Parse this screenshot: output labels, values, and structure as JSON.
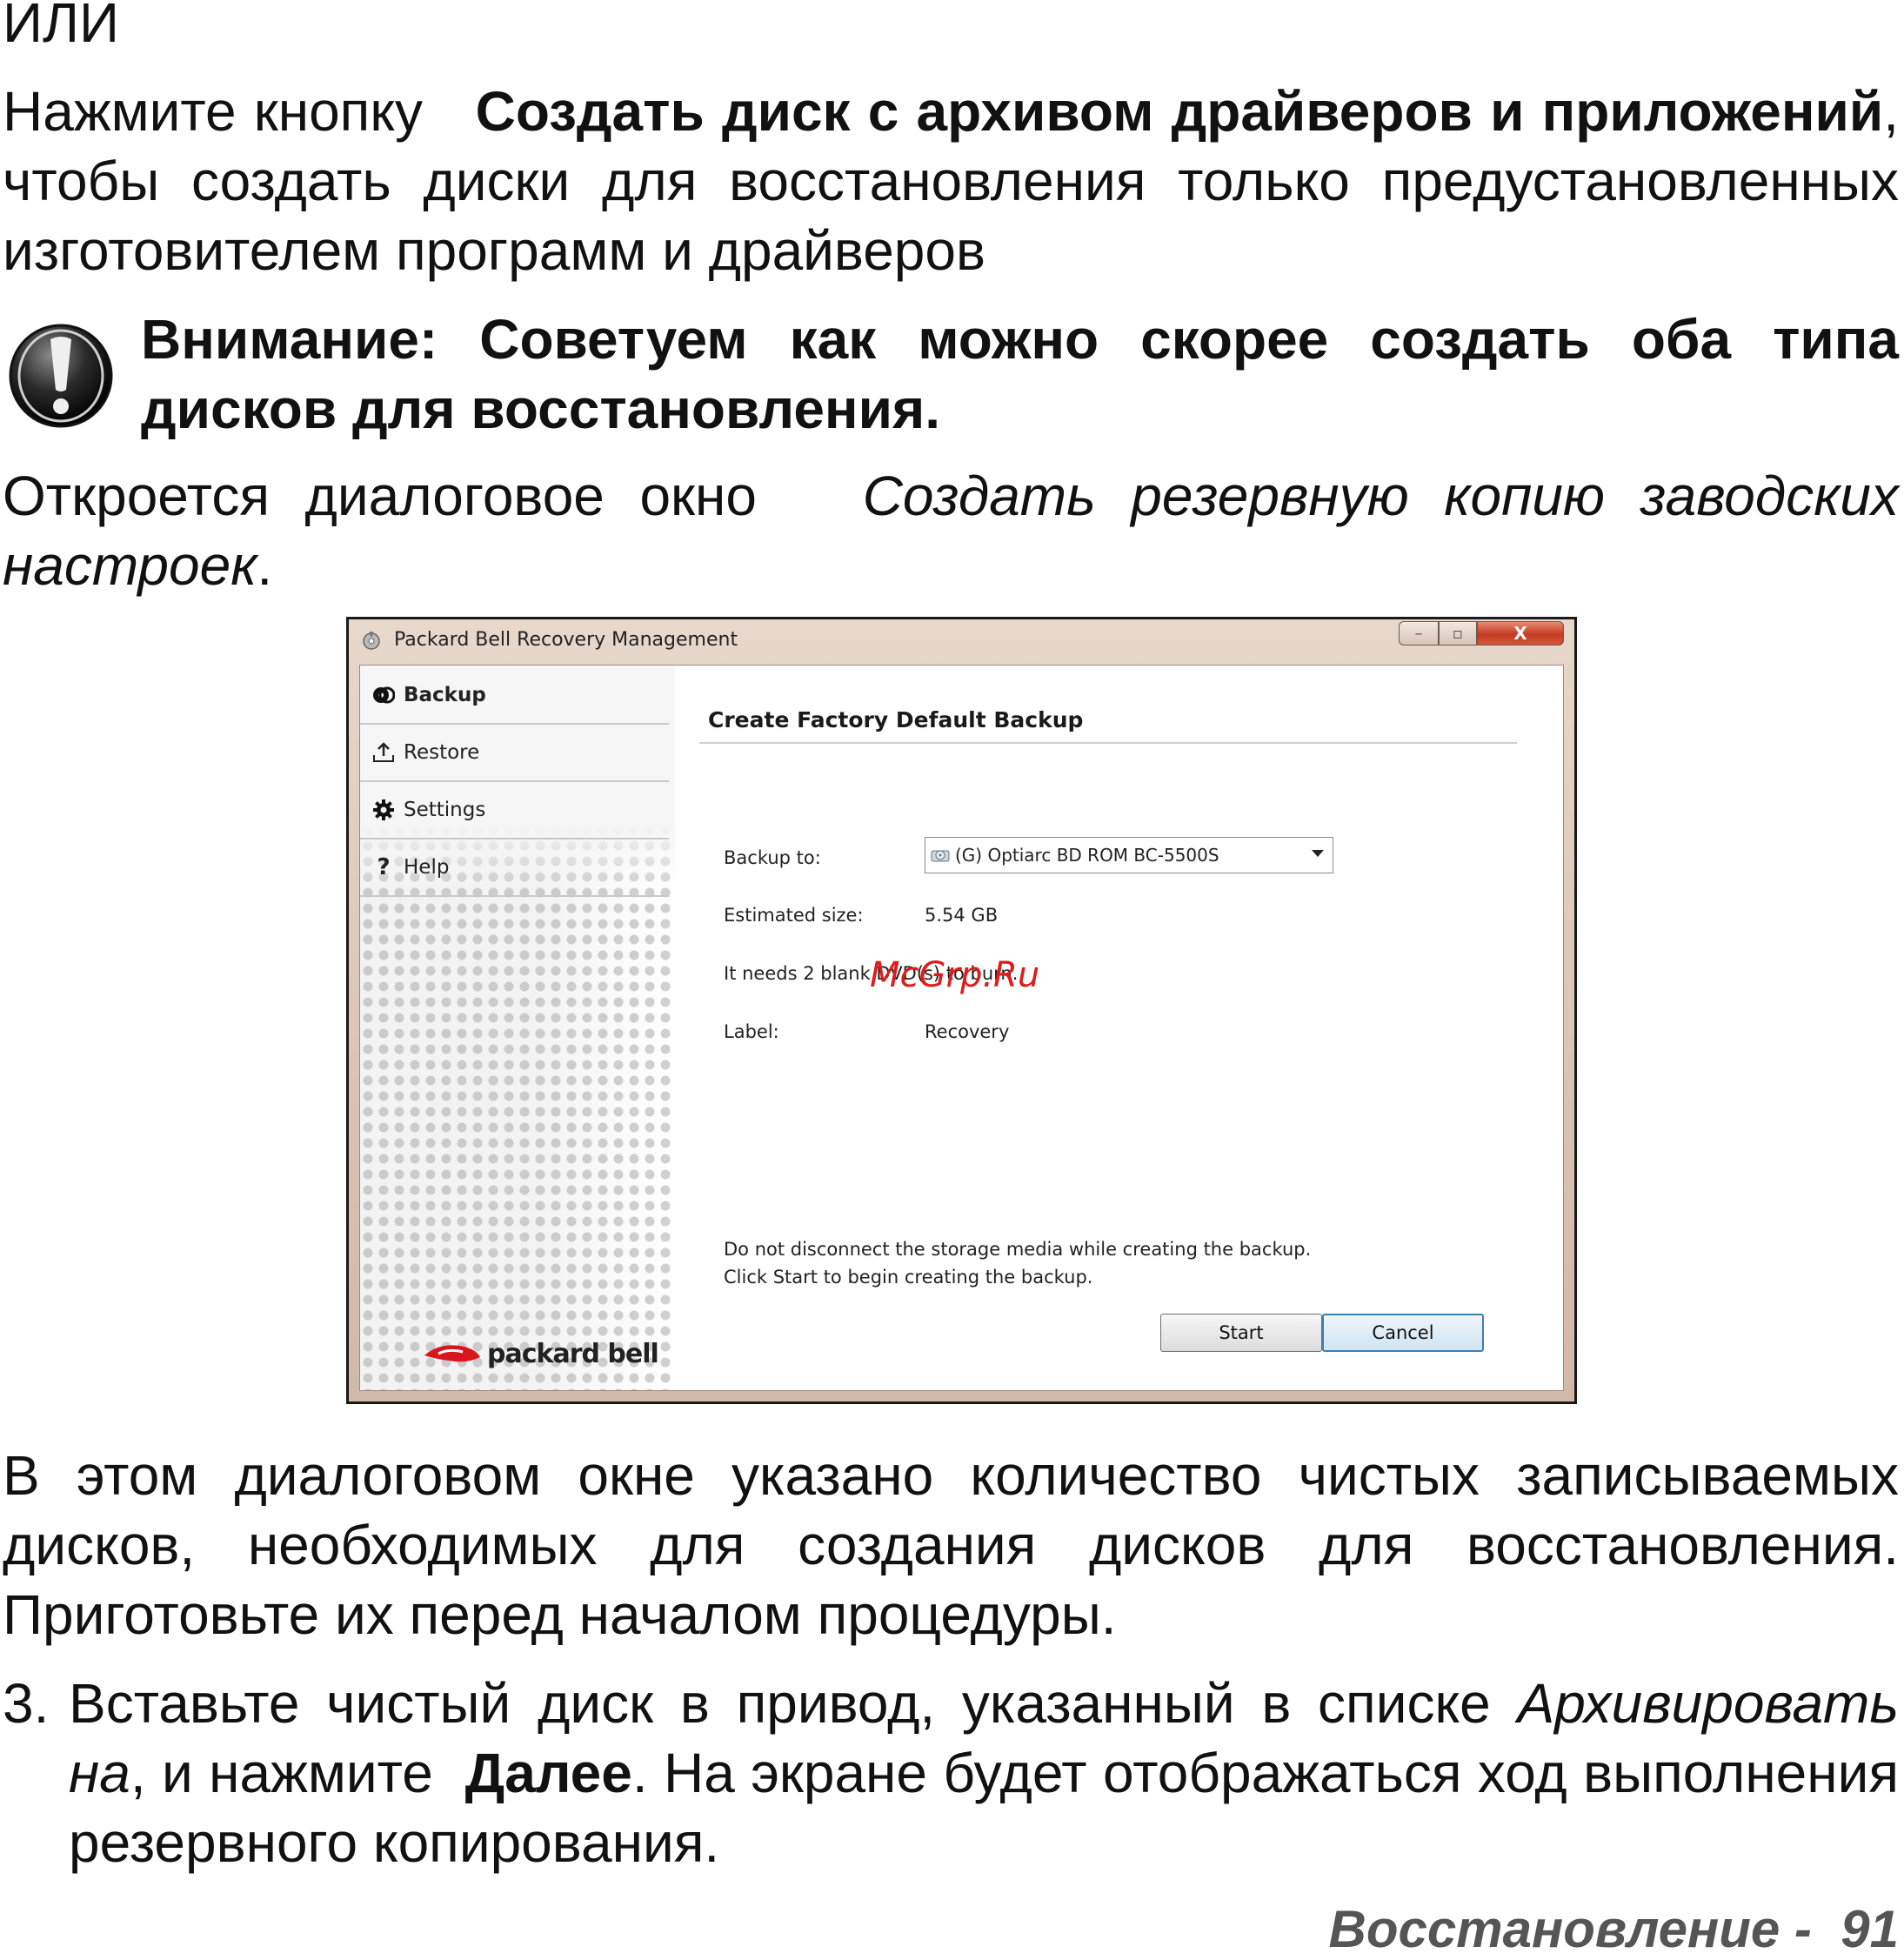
{
  "doc": {
    "top_word": "ИЛИ",
    "para1": {
      "lead": "Нажмите кнопку",
      "bold": "Создать диск с архивом драйверов и приложений",
      "rest": ", чтобы создать диски для восстановления только предустановленных изготовителем программ и драйверов"
    },
    "warning": "Внимание: Советуем как можно скорее создать оба типа дисков для восстановления.",
    "para2": {
      "lead": "Откроется диалоговое окно",
      "italic": "Создать резервную копию заводских настроек",
      "tail": "."
    },
    "para3": "В этом диалоговом окне указано количество чистых записываемых дисков, необходимых для создания дисков для восстановления. Приготовьте их перед началом процедуры.",
    "step3": {
      "num": "3.",
      "text1": "Вставьте чистый диск в привод, указанный в списке",
      "italic1": "Архивировать на",
      "text2": ", и нажмите",
      "bold": "Далее",
      "text3": ". На экране будет отображаться ход выполнения резервного копирования."
    },
    "footer": "Восстановление -  91"
  },
  "window": {
    "title": "Packard Bell Recovery Management",
    "controls": {
      "minimize": "–",
      "maximize": "▫",
      "close": "X"
    },
    "nav": [
      {
        "label": "Backup",
        "icon": "backup-disc-icon"
      },
      {
        "label": "Restore",
        "icon": "restore-upload-icon"
      },
      {
        "label": "Settings",
        "icon": "gear-icon"
      },
      {
        "label": "Help",
        "icon": "question-mark-icon"
      }
    ],
    "heading": "Create Factory Default Backup",
    "backup_to_label": "Backup to:",
    "backup_to_value": "(G) Optiarc  BD ROM BC-5500S",
    "estimated_size_label": "Estimated size:",
    "estimated_size_value": "5.54 GB",
    "needs_text": "It needs 2 blank DVD(s) to burn.",
    "label_label": "Label:",
    "label_value": "Recovery",
    "note1": "Do not disconnect the storage media while creating the backup.",
    "note2": "Click Start to begin creating the backup.",
    "start_button": "Start",
    "cancel_button": "Cancel",
    "logo_text": "packard bell"
  },
  "watermark": "McGrp.Ru",
  "colors": {
    "watermark": "#e01b1b",
    "close_button": "#c23b22",
    "cancel_border": "#3c7fb1"
  }
}
